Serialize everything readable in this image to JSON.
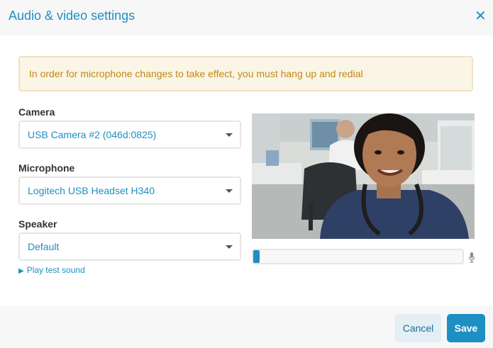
{
  "dialog": {
    "title": "Audio & video settings"
  },
  "notice": "In order for microphone changes to take effect, you must hang up and redial",
  "camera": {
    "label": "Camera",
    "selected": "USB Camera #2 (046d:0825)"
  },
  "microphone": {
    "label": "Microphone",
    "selected": "Logitech USB Headset H340"
  },
  "speaker": {
    "label": "Speaker",
    "selected": "Default"
  },
  "play_test_sound": "Play test sound",
  "mic_level": 0.03,
  "buttons": {
    "cancel": "Cancel",
    "save": "Save"
  },
  "colors": {
    "accent": "#1e8fc2",
    "notice_text": "#bd8a14",
    "notice_bg": "#fbf5e6"
  },
  "icons": {
    "close": "close-icon",
    "mic": "microphone-icon",
    "play": "play-icon",
    "caret": "chevron-down-icon"
  }
}
